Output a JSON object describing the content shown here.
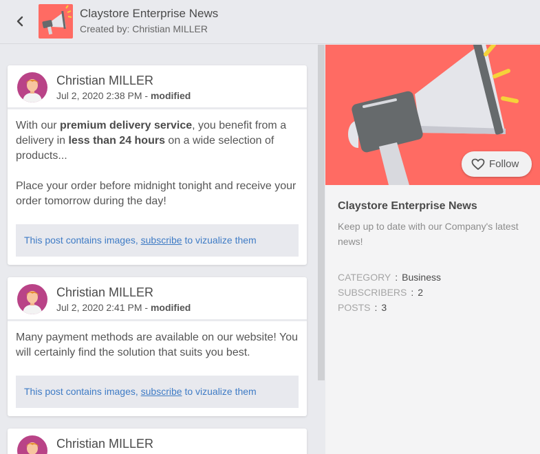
{
  "header": {
    "title": "Claystore Enterprise News",
    "created_by": "Created by: Christian MILLER"
  },
  "posts": [
    {
      "author": "Christian MILLER",
      "date": "Jul 2, 2020 2:38 PM",
      "modified_sep": " - ",
      "modified": "modified",
      "p1_a": "With our ",
      "p1_b": "premium delivery service",
      "p1_c": ", you benefit from a delivery in ",
      "p1_d": "less than 24 hours",
      "p1_e": " on a wide selection of products...",
      "p2": "Place your order before midnight tonight and receive your order tomorrow during the day!",
      "notice_a": "This post contains images, ",
      "notice_link": "subscribe",
      "notice_b": " to vizualize them"
    },
    {
      "author": "Christian MILLER",
      "date": "Jul 2, 2020 2:41 PM",
      "modified_sep": " - ",
      "modified": "modified",
      "p1": "Many payment methods are available on our website! You will certainly find the solution that suits you best.",
      "notice_a": "This post contains images, ",
      "notice_link": "subscribe",
      "notice_b": " to vizualize them"
    },
    {
      "author": "Christian MILLER"
    }
  ],
  "panel": {
    "follow_label": "Follow",
    "title": "Claystore Enterprise News",
    "description": "Keep up to date with our Company's latest news!",
    "stats": [
      {
        "key": "CATEGORY",
        "sep": ":",
        "value": "Business"
      },
      {
        "key": "SUBSCRIBERS",
        "sep": ":",
        "value": "2"
      },
      {
        "key": "POSTS",
        "sep": ":",
        "value": "3"
      }
    ]
  },
  "icons": {
    "back": "chevron-left-icon",
    "megaphone": "megaphone-icon",
    "heart": "heart-icon",
    "avatar": "person-avatar"
  },
  "colors": {
    "accent": "#ff6b63",
    "avatar_bg": "#b94387",
    "link": "#3e7bc5"
  }
}
